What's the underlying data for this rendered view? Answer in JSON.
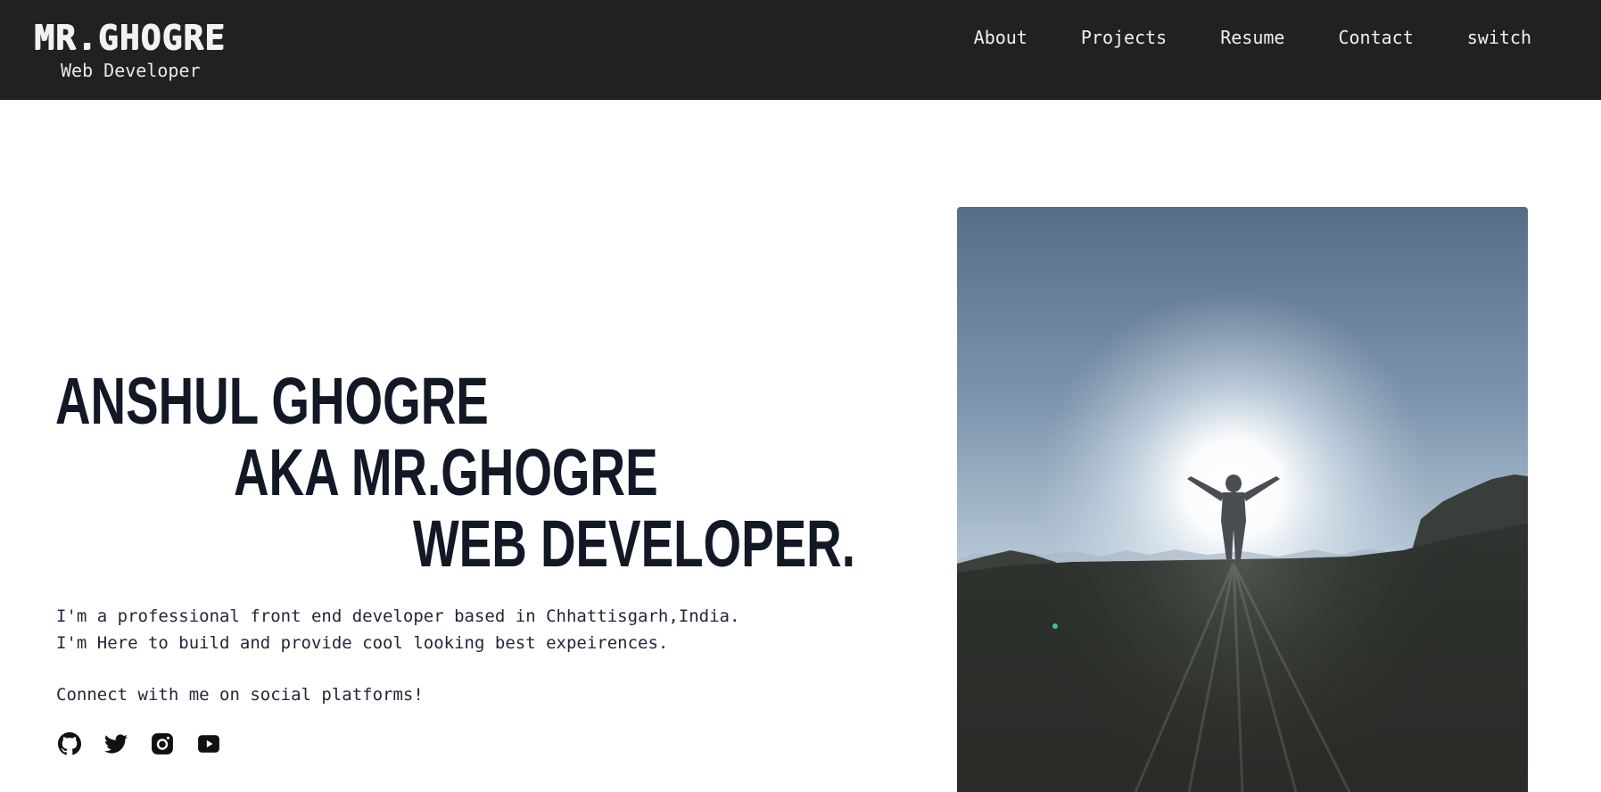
{
  "header": {
    "logo": "MR.GHOGRE",
    "subtitle": "Web Developer",
    "nav": [
      "About",
      "Projects",
      "Resume",
      "Contact",
      "switch"
    ]
  },
  "hero": {
    "line1": "ANSHUL GHOGRE",
    "line2": "AKA MR.GHOGRE",
    "line3": "WEB DEVELOPER.",
    "intro1": "I'm a professional front end developer based in Chhattisgarh,India.",
    "intro2": "I'm Here to build and provide cool looking best expeirences.",
    "cta": "Connect with me on social platforms!"
  },
  "socials": [
    "github-icon",
    "twitter-icon",
    "instagram-icon",
    "youtube-icon"
  ],
  "colors": {
    "header_bg": "#212121",
    "header_text": "#f0f0f0",
    "heading": "#121826",
    "body_text": "#23263a",
    "page_bg": "#ffffff"
  }
}
